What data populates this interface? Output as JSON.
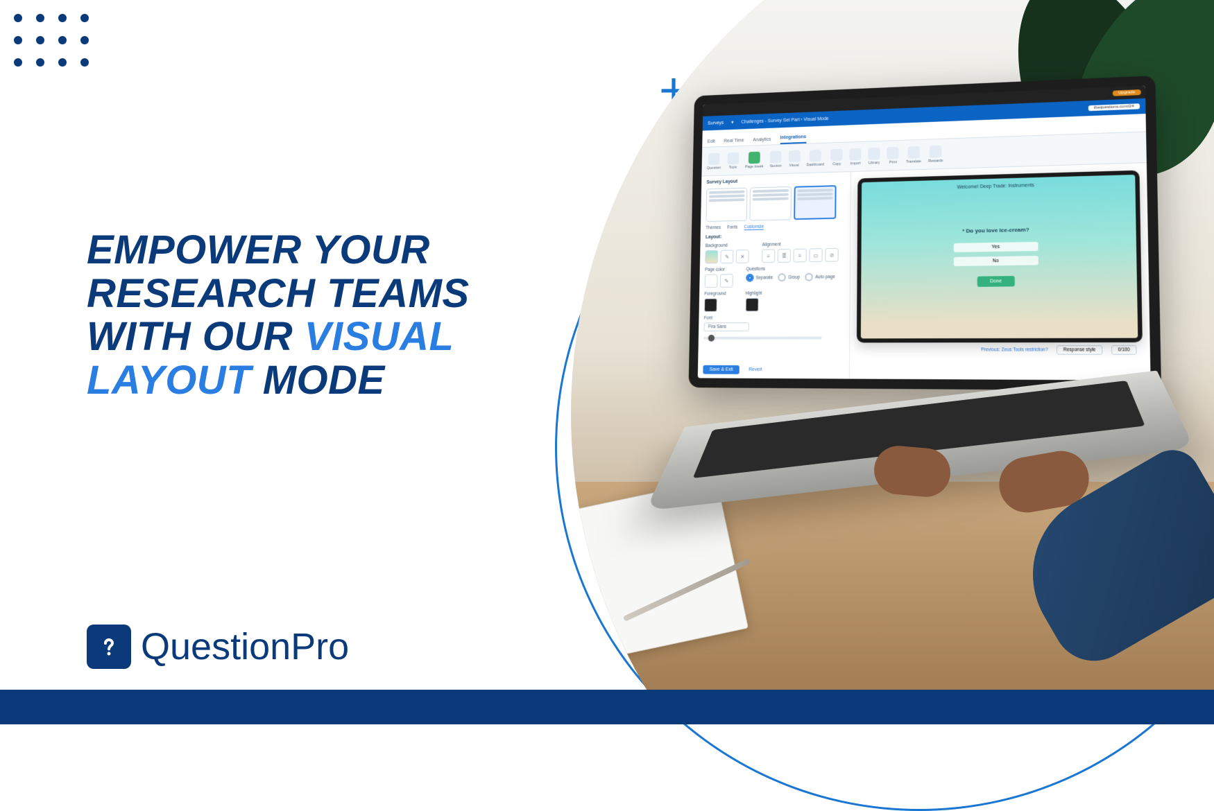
{
  "headline": {
    "l1a": "EMPOWER YOUR",
    "l2a": "RESEARCH TEAMS",
    "l3a": "WITH OUR ",
    "l3b": "VISUAL",
    "l4a": "LAYOUT",
    "l4b": " MODE"
  },
  "logo": {
    "text": "QuestionPro"
  },
  "app": {
    "top_pill": "Upgrade",
    "nav": {
      "surveys": "Surveys",
      "breadcrumb": "Challenges - Survey Set Part  ›  Visual Mode",
      "url": "thequestions.com/24"
    },
    "tabs": {
      "t1": "Edit",
      "t2": "Real Time",
      "t3": "Analytics",
      "t4": "Integrations"
    },
    "ribbon": {
      "r1": "Question",
      "r2": "Topic",
      "r3": "Page break",
      "r4": "Section",
      "r5": "Visual",
      "r6": "Dashboard",
      "r7": "Copy",
      "r8": "Import",
      "r9": "Library",
      "r10": "Print",
      "r11": "Translate",
      "r12": "Rewards",
      "r13": "",
      "r14": ""
    },
    "left": {
      "surveyLayout": "Survey Layout",
      "themes": "Themes",
      "fonts": "Fonts",
      "customize": "Customize",
      "layoutLabel": "Layout:",
      "bgLabel": "Background",
      "alignLabel": "Alignment",
      "questionsLabel": "Questions",
      "pageColor": "Page color",
      "bgColor": "Background",
      "opt_separate": "Separate",
      "opt_group": "Group",
      "opt_autoPage": "Auto page",
      "fgLabel": "Foreground",
      "hlLabel": "Highlight",
      "fontLabel": "Font",
      "fontValue": "Fira Sans",
      "saveBtn": "Save & Exit",
      "revertBtn": "Revert"
    },
    "canvas": {
      "title": "Welcome! Deep Trade: Instruments",
      "question": "* Do you love ice-cream?",
      "opt1": "Yes",
      "opt2": "No",
      "done": "Done"
    },
    "footer": {
      "link": "Previous: Zeus Tools restriction?",
      "view1": "Response style",
      "view2": "0/100"
    }
  }
}
